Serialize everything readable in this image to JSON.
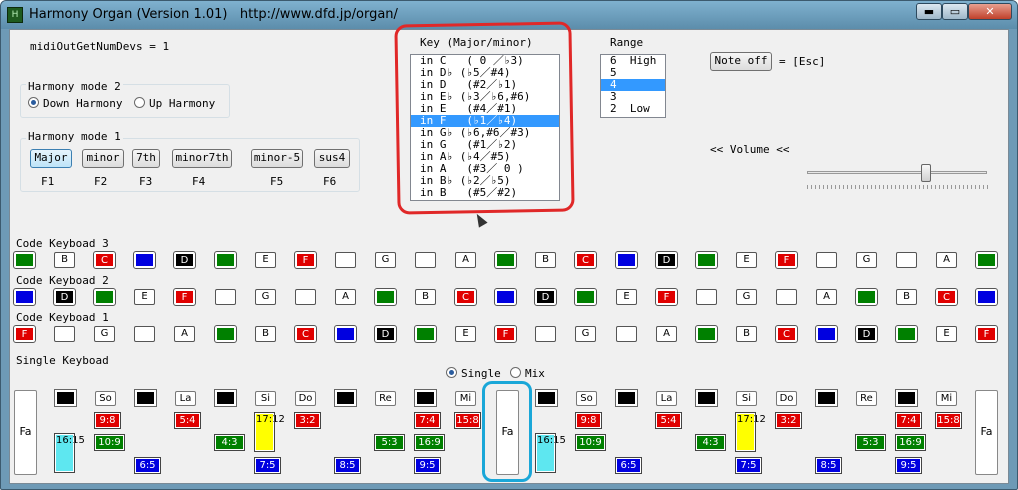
{
  "window": {
    "title": "Harmony Organ (Version 1.01)   http://www.dfd.jp/organ/",
    "icon_name": "harmony-organ-app-icon",
    "icon_text": "H",
    "buttons": {
      "minimize": "▬",
      "maximize": "▭",
      "close": "✕"
    }
  },
  "status": {
    "midi_devs": "midiOutGetNumDevs = 1"
  },
  "harmony_mode_2": {
    "label": "Harmony mode 2",
    "options": [
      {
        "label": "Down Harmony",
        "selected": true
      },
      {
        "label": "Up Harmony",
        "selected": false
      }
    ]
  },
  "harmony_mode_1": {
    "label": "Harmony mode 1",
    "buttons": [
      {
        "label": "Major",
        "fkey": "F1",
        "selected": true
      },
      {
        "label": "minor",
        "fkey": "F2",
        "selected": false
      },
      {
        "label": "7th",
        "fkey": "F3",
        "selected": false
      },
      {
        "label": "minor7th",
        "fkey": "F4",
        "selected": false
      },
      {
        "label": "minor-5",
        "fkey": "F5",
        "selected": false
      },
      {
        "label": "sus4",
        "fkey": "F6",
        "selected": false
      }
    ]
  },
  "key": {
    "header": "Key    (Major/minor)",
    "selected_index": 5,
    "items": [
      "in C   ( 0 ／♭3)",
      "in D♭ (♭5／#4)",
      "in D   (#2／♭1)",
      "in E♭ (♭3／♭6,#6)",
      "in E   (#4／#1)",
      "in F   (♭1／♭4)",
      "in G♭ (♭6,#6／#3)",
      "in G   (#1／♭2)",
      "in A♭ (♭4／#5)",
      "in A   (#3／ 0 )",
      "in B♭ (♭2／♭5)",
      "in B   (#5／#2)"
    ]
  },
  "range": {
    "header": "Range",
    "selected_index": 2,
    "items": [
      "6  High",
      "5",
      "4",
      "3",
      "2  Low"
    ]
  },
  "note_off": {
    "label": "Note off",
    "shortcut": "= [Esc]"
  },
  "volume": {
    "label": "<< Volume <<",
    "value_fraction": 0.72
  },
  "keyboards": {
    "code3": {
      "label": "Code Keyboad 3",
      "keys": [
        "green",
        "B",
        "C|red",
        "blue",
        "D|black",
        "green",
        "E",
        "F|red",
        "",
        "G",
        "",
        "A",
        "green",
        "B",
        "C|red",
        "blue",
        "D|black",
        "green",
        "E",
        "F|red",
        "",
        "G",
        "",
        "A",
        "green"
      ]
    },
    "code2": {
      "label": "Code Keyboad 2",
      "keys": [
        "blue",
        "D|black",
        "green",
        "E",
        "F|red",
        "",
        "G",
        "",
        "A",
        "green",
        "B",
        "C|red",
        "blue",
        "D|black",
        "green",
        "E",
        "F|red",
        "",
        "G",
        "",
        "A",
        "green",
        "B",
        "C|red",
        "blue"
      ]
    },
    "code1": {
      "label": "Code Keyboad 1",
      "keys": [
        "F|red",
        "",
        "G",
        "",
        "A",
        "green",
        "B",
        "C|red",
        "blue",
        "D|black",
        "green",
        "E",
        "F|red",
        "",
        "G",
        "",
        "A",
        "green",
        "B",
        "C|red",
        "blue",
        "D|black",
        "green",
        "E",
        "F|red"
      ]
    }
  },
  "single": {
    "label": "Single Keyboad",
    "modes": [
      {
        "label": "Single",
        "selected": true
      },
      {
        "label": "Mix",
        "selected": false
      }
    ],
    "fa_label": "Fa",
    "notes_a": [
      "So",
      "La",
      "Si",
      "Do",
      "Re",
      "Mi"
    ],
    "notes_b": [
      "So",
      "La",
      "Si",
      "Do",
      "Re",
      "Mi"
    ],
    "ratios_a": [
      "9:8",
      "5:4",
      "17:12",
      "3:2",
      "7:4",
      "15:8"
    ],
    "ratios_a2": [
      "16:15",
      "10:9",
      "4:3",
      "5:3",
      "16:9"
    ],
    "ratios_a3": [
      "6:5",
      "7:5",
      "8:5",
      "9:5"
    ],
    "ratios_b": [
      "9:8",
      "5:4",
      "17:12",
      "3:2",
      "7:4",
      "15:8"
    ],
    "ratios_b2": [
      "16:15",
      "10:9",
      "4:3",
      "5:3",
      "16:9"
    ],
    "ratios_b3": [
      "6:5",
      "7:5",
      "8:5",
      "9:5"
    ]
  },
  "colors": {
    "red": "#e00000",
    "green": "#008000",
    "blue": "#0000e0",
    "black": "#000000",
    "annotation_red": "#e02828",
    "annotation_blue": "#1aa7d8"
  }
}
